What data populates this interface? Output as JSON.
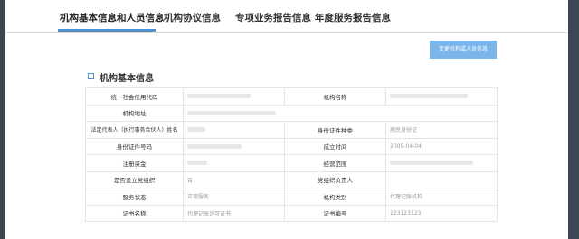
{
  "tabs": [
    {
      "label": "机构基本信息和人员信息",
      "active": true
    },
    {
      "label": "机构协议信息",
      "active": false
    },
    {
      "label": "专项业务报告信息",
      "active": false
    },
    {
      "label": "年度服务报告信息",
      "active": false
    }
  ],
  "change_button": {
    "label": "变更机构或人员信息"
  },
  "section": {
    "title": "机构基本信息"
  },
  "rows": [
    {
      "l1": "统一社会信用代码",
      "v1": "",
      "l2": "机构名称",
      "v2": ""
    },
    {
      "l1": "机构地址",
      "v1": "",
      "l2": "",
      "v2": ""
    },
    {
      "l1": "法定代表人（执行事务合伙人）姓名",
      "v1": "",
      "l2": "身份证件种类",
      "v2": "居民身份证"
    },
    {
      "l1": "身份证件号码",
      "v1": "",
      "l2": "成立时间",
      "v2": "2005-04-04"
    },
    {
      "l1": "注册资金",
      "v1": "",
      "l2": "经营范围",
      "v2": ""
    },
    {
      "l1": "是否设立党组织",
      "v1": "否",
      "l2": "党组织负责人",
      "v2": ""
    },
    {
      "l1": "服务状态",
      "v1": "正常服务",
      "l2": "机构类别",
      "v2": "代理记账机构"
    },
    {
      "l1": "证书名称",
      "v1": "代理记账许可证书",
      "l2": "证书编号",
      "v2": "123123123"
    }
  ],
  "colors": {
    "accent": "#4a8fd0",
    "button": "#7ab6ea",
    "frame": "#3e4654"
  }
}
